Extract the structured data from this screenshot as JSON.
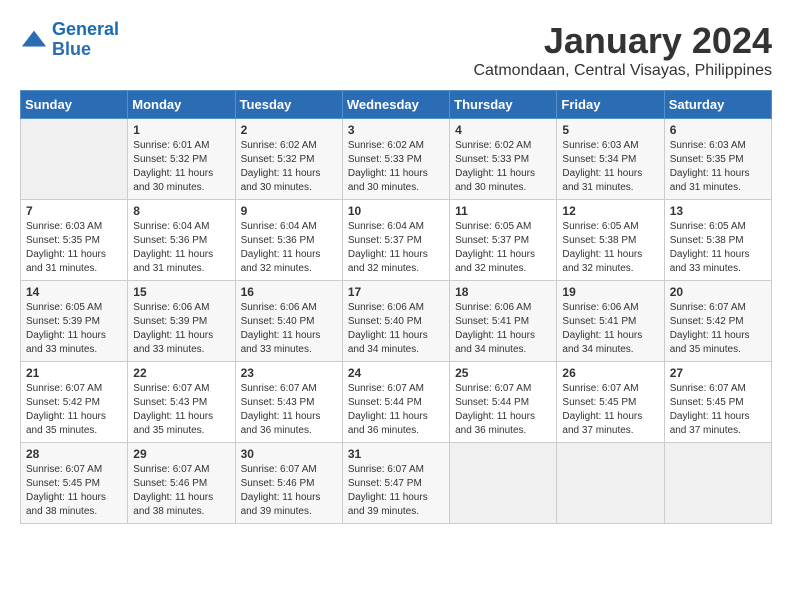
{
  "header": {
    "logo": {
      "line1": "General",
      "line2": "Blue"
    },
    "title": "January 2024",
    "subtitle": "Catmondaan, Central Visayas, Philippines"
  },
  "weekdays": [
    "Sunday",
    "Monday",
    "Tuesday",
    "Wednesday",
    "Thursday",
    "Friday",
    "Saturday"
  ],
  "weeks": [
    [
      {
        "day": "",
        "sunrise": "",
        "sunset": "",
        "daylight": ""
      },
      {
        "day": "1",
        "sunrise": "Sunrise: 6:01 AM",
        "sunset": "Sunset: 5:32 PM",
        "daylight": "Daylight: 11 hours and 30 minutes."
      },
      {
        "day": "2",
        "sunrise": "Sunrise: 6:02 AM",
        "sunset": "Sunset: 5:32 PM",
        "daylight": "Daylight: 11 hours and 30 minutes."
      },
      {
        "day": "3",
        "sunrise": "Sunrise: 6:02 AM",
        "sunset": "Sunset: 5:33 PM",
        "daylight": "Daylight: 11 hours and 30 minutes."
      },
      {
        "day": "4",
        "sunrise": "Sunrise: 6:02 AM",
        "sunset": "Sunset: 5:33 PM",
        "daylight": "Daylight: 11 hours and 30 minutes."
      },
      {
        "day": "5",
        "sunrise": "Sunrise: 6:03 AM",
        "sunset": "Sunset: 5:34 PM",
        "daylight": "Daylight: 11 hours and 31 minutes."
      },
      {
        "day": "6",
        "sunrise": "Sunrise: 6:03 AM",
        "sunset": "Sunset: 5:35 PM",
        "daylight": "Daylight: 11 hours and 31 minutes."
      }
    ],
    [
      {
        "day": "7",
        "sunrise": "Sunrise: 6:03 AM",
        "sunset": "Sunset: 5:35 PM",
        "daylight": "Daylight: 11 hours and 31 minutes."
      },
      {
        "day": "8",
        "sunrise": "Sunrise: 6:04 AM",
        "sunset": "Sunset: 5:36 PM",
        "daylight": "Daylight: 11 hours and 31 minutes."
      },
      {
        "day": "9",
        "sunrise": "Sunrise: 6:04 AM",
        "sunset": "Sunset: 5:36 PM",
        "daylight": "Daylight: 11 hours and 32 minutes."
      },
      {
        "day": "10",
        "sunrise": "Sunrise: 6:04 AM",
        "sunset": "Sunset: 5:37 PM",
        "daylight": "Daylight: 11 hours and 32 minutes."
      },
      {
        "day": "11",
        "sunrise": "Sunrise: 6:05 AM",
        "sunset": "Sunset: 5:37 PM",
        "daylight": "Daylight: 11 hours and 32 minutes."
      },
      {
        "day": "12",
        "sunrise": "Sunrise: 6:05 AM",
        "sunset": "Sunset: 5:38 PM",
        "daylight": "Daylight: 11 hours and 32 minutes."
      },
      {
        "day": "13",
        "sunrise": "Sunrise: 6:05 AM",
        "sunset": "Sunset: 5:38 PM",
        "daylight": "Daylight: 11 hours and 33 minutes."
      }
    ],
    [
      {
        "day": "14",
        "sunrise": "Sunrise: 6:05 AM",
        "sunset": "Sunset: 5:39 PM",
        "daylight": "Daylight: 11 hours and 33 minutes."
      },
      {
        "day": "15",
        "sunrise": "Sunrise: 6:06 AM",
        "sunset": "Sunset: 5:39 PM",
        "daylight": "Daylight: 11 hours and 33 minutes."
      },
      {
        "day": "16",
        "sunrise": "Sunrise: 6:06 AM",
        "sunset": "Sunset: 5:40 PM",
        "daylight": "Daylight: 11 hours and 33 minutes."
      },
      {
        "day": "17",
        "sunrise": "Sunrise: 6:06 AM",
        "sunset": "Sunset: 5:40 PM",
        "daylight": "Daylight: 11 hours and 34 minutes."
      },
      {
        "day": "18",
        "sunrise": "Sunrise: 6:06 AM",
        "sunset": "Sunset: 5:41 PM",
        "daylight": "Daylight: 11 hours and 34 minutes."
      },
      {
        "day": "19",
        "sunrise": "Sunrise: 6:06 AM",
        "sunset": "Sunset: 5:41 PM",
        "daylight": "Daylight: 11 hours and 34 minutes."
      },
      {
        "day": "20",
        "sunrise": "Sunrise: 6:07 AM",
        "sunset": "Sunset: 5:42 PM",
        "daylight": "Daylight: 11 hours and 35 minutes."
      }
    ],
    [
      {
        "day": "21",
        "sunrise": "Sunrise: 6:07 AM",
        "sunset": "Sunset: 5:42 PM",
        "daylight": "Daylight: 11 hours and 35 minutes."
      },
      {
        "day": "22",
        "sunrise": "Sunrise: 6:07 AM",
        "sunset": "Sunset: 5:43 PM",
        "daylight": "Daylight: 11 hours and 35 minutes."
      },
      {
        "day": "23",
        "sunrise": "Sunrise: 6:07 AM",
        "sunset": "Sunset: 5:43 PM",
        "daylight": "Daylight: 11 hours and 36 minutes."
      },
      {
        "day": "24",
        "sunrise": "Sunrise: 6:07 AM",
        "sunset": "Sunset: 5:44 PM",
        "daylight": "Daylight: 11 hours and 36 minutes."
      },
      {
        "day": "25",
        "sunrise": "Sunrise: 6:07 AM",
        "sunset": "Sunset: 5:44 PM",
        "daylight": "Daylight: 11 hours and 36 minutes."
      },
      {
        "day": "26",
        "sunrise": "Sunrise: 6:07 AM",
        "sunset": "Sunset: 5:45 PM",
        "daylight": "Daylight: 11 hours and 37 minutes."
      },
      {
        "day": "27",
        "sunrise": "Sunrise: 6:07 AM",
        "sunset": "Sunset: 5:45 PM",
        "daylight": "Daylight: 11 hours and 37 minutes."
      }
    ],
    [
      {
        "day": "28",
        "sunrise": "Sunrise: 6:07 AM",
        "sunset": "Sunset: 5:45 PM",
        "daylight": "Daylight: 11 hours and 38 minutes."
      },
      {
        "day": "29",
        "sunrise": "Sunrise: 6:07 AM",
        "sunset": "Sunset: 5:46 PM",
        "daylight": "Daylight: 11 hours and 38 minutes."
      },
      {
        "day": "30",
        "sunrise": "Sunrise: 6:07 AM",
        "sunset": "Sunset: 5:46 PM",
        "daylight": "Daylight: 11 hours and 39 minutes."
      },
      {
        "day": "31",
        "sunrise": "Sunrise: 6:07 AM",
        "sunset": "Sunset: 5:47 PM",
        "daylight": "Daylight: 11 hours and 39 minutes."
      },
      {
        "day": "",
        "sunrise": "",
        "sunset": "",
        "daylight": ""
      },
      {
        "day": "",
        "sunrise": "",
        "sunset": "",
        "daylight": ""
      },
      {
        "day": "",
        "sunrise": "",
        "sunset": "",
        "daylight": ""
      }
    ]
  ]
}
